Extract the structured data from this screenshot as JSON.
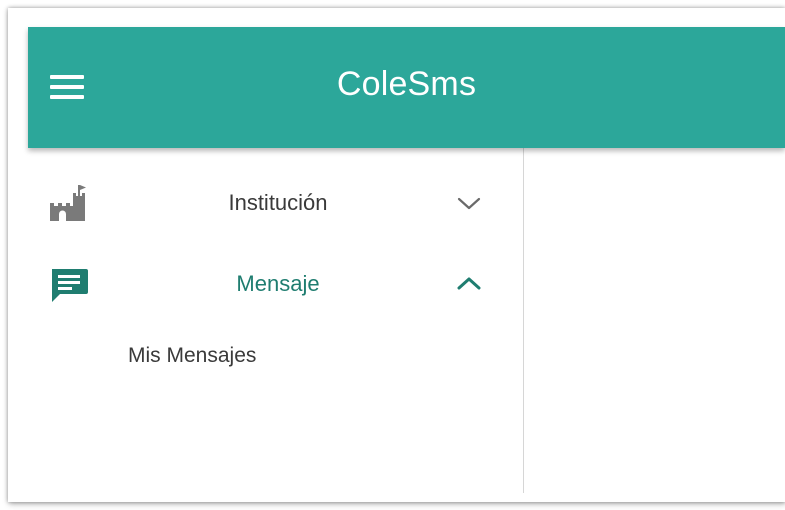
{
  "app_bar": {
    "title": "ColeSms",
    "menu_icon": "hamburger-menu-icon",
    "background_color": "#2ca79a",
    "title_color": "#ffffff"
  },
  "drawer": {
    "items": [
      {
        "label": "Institución",
        "icon": "castle-icon",
        "expanded": false,
        "chevron_icon": "chevron-down-icon",
        "icon_color": "#7a7a7a"
      },
      {
        "label": "Mensaje",
        "icon": "message-icon",
        "expanded": true,
        "chevron_icon": "chevron-up-icon",
        "icon_color": "#1f7d70",
        "active_color": "#1f7d70",
        "subitems": [
          {
            "label": "Mis Mensajes"
          }
        ]
      }
    ]
  }
}
